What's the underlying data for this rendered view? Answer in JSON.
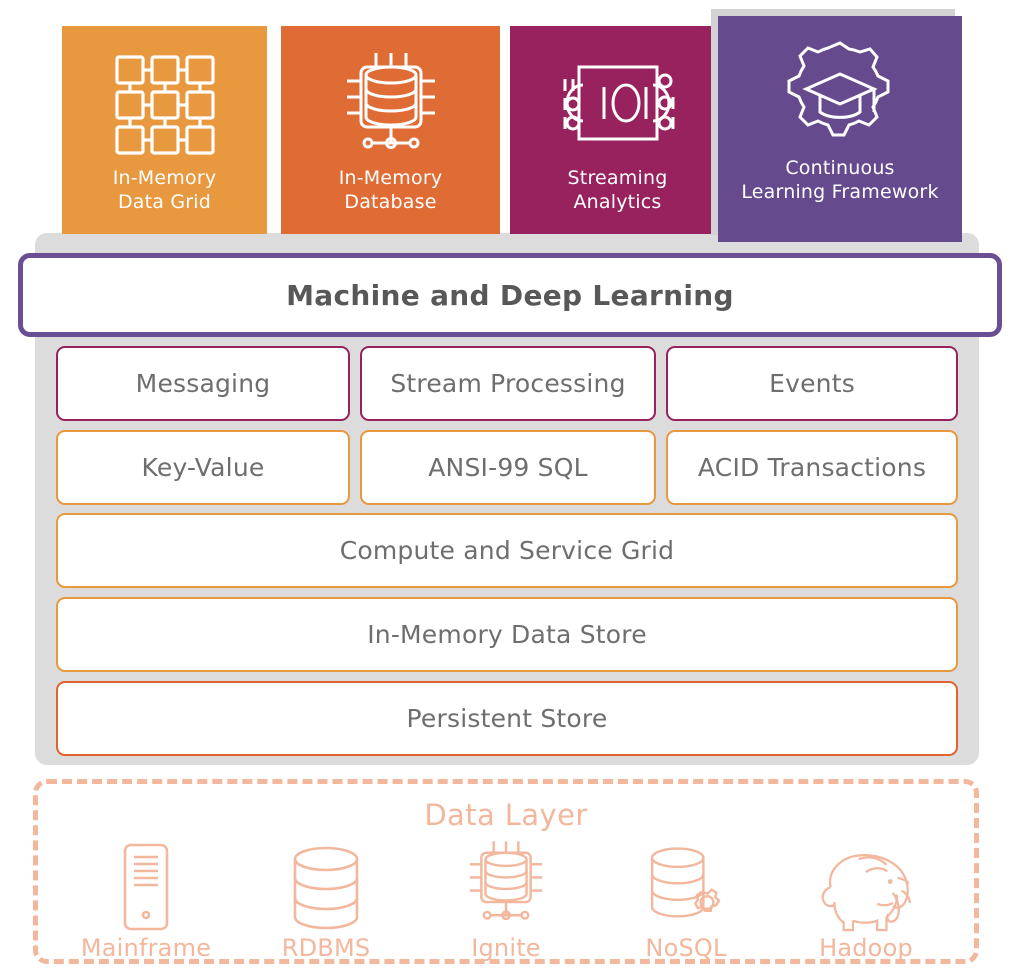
{
  "capability_tiles": [
    {
      "label": "In-Memory\nData Grid",
      "label_lines": [
        "In-Memory",
        "Data Grid"
      ],
      "color": "#e8983e",
      "icon": "grid-nodes-icon",
      "raised": false
    },
    {
      "label": "In-Memory\nDatabase",
      "label_lines": [
        "In-Memory",
        "Database"
      ],
      "color": "#e06c35",
      "icon": "chip-database-icon",
      "raised": false
    },
    {
      "label": "Streaming\nAnalytics",
      "label_lines": [
        "Streaming",
        "Analytics"
      ],
      "color": "#97225e",
      "icon": "binary-stream-icon",
      "raised": false
    },
    {
      "label": "Continuous\nLearning Framework",
      "label_lines": [
        "Continuous",
        "Learning Framework"
      ],
      "color": "#654a8e",
      "icon": "gear-graduation-cap-icon",
      "raised": true
    }
  ],
  "platform": {
    "banner": {
      "label": "Machine and Deep Learning",
      "border_color": "#6b4f94",
      "text_color": "#585858"
    },
    "rows": [
      {
        "border_color": "#97225e",
        "cells": [
          "Messaging",
          "Stream Processing",
          "Events"
        ]
      },
      {
        "border_color": "#e8983e",
        "cells": [
          "Key-Value",
          "ANSI-99 SQL",
          "ACID Transactions"
        ]
      }
    ],
    "wide_rows": [
      {
        "label": "Compute and Service Grid",
        "border_color": "#e8983e"
      },
      {
        "label": "In-Memory Data Store",
        "border_color": "#e8983e"
      },
      {
        "label": "Persistent Store",
        "border_color": "#e0622f"
      }
    ],
    "panel_color": "#dcdcdc"
  },
  "data_layer": {
    "title": "Data Layer",
    "accent_color": "#f2b79c",
    "border_style": "dashed",
    "items": [
      {
        "label": "Mainframe",
        "icon": "mainframe-tower-icon"
      },
      {
        "label": "RDBMS",
        "icon": "database-cylinder-icon"
      },
      {
        "label": "Ignite",
        "icon": "chip-database-icon"
      },
      {
        "label": "NoSQL",
        "icon": "database-gear-icon"
      },
      {
        "label": "Hadoop",
        "icon": "elephant-icon"
      }
    ]
  }
}
